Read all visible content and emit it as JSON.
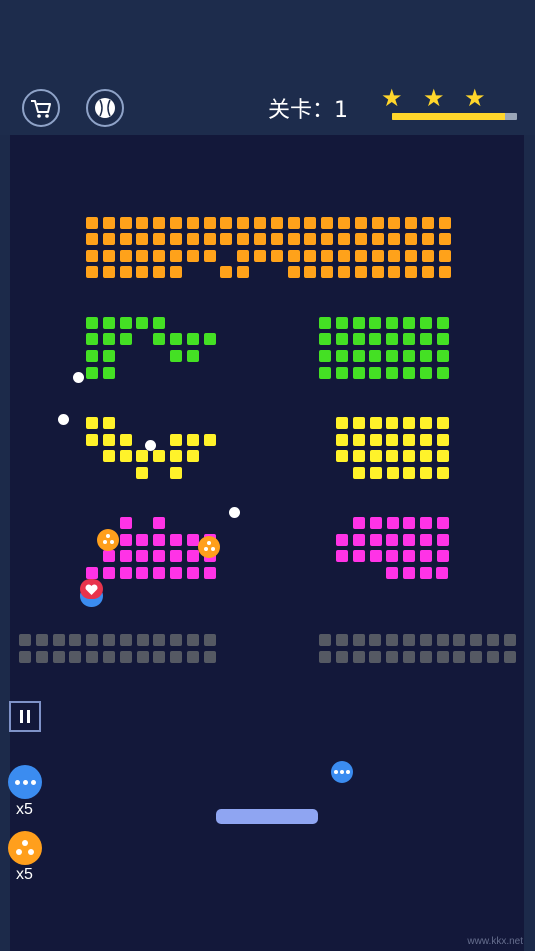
{
  "header": {
    "level_text": "关卡：1",
    "stars_earned": 3,
    "stars_total": 3,
    "star_glyph": "★",
    "progress_fraction": 0.9,
    "icons": [
      "shopping-cart-icon",
      "baseball-icon"
    ]
  },
  "colors": {
    "background": "#1c2a4a",
    "playfield": "#13183a",
    "orange": "#ffa21a",
    "green": "#44e024",
    "yellow": "#fff22a",
    "magenta": "#ff33e6",
    "gray": "#555963",
    "star": "#ffd62b",
    "paddle": "#8fa5f2",
    "multiball": "#3b8cf0",
    "split": "#ff9f1c"
  },
  "powerups": {
    "multiball_count": "x5",
    "split_count": "x5"
  },
  "watermark": "www.kkx.net"
}
